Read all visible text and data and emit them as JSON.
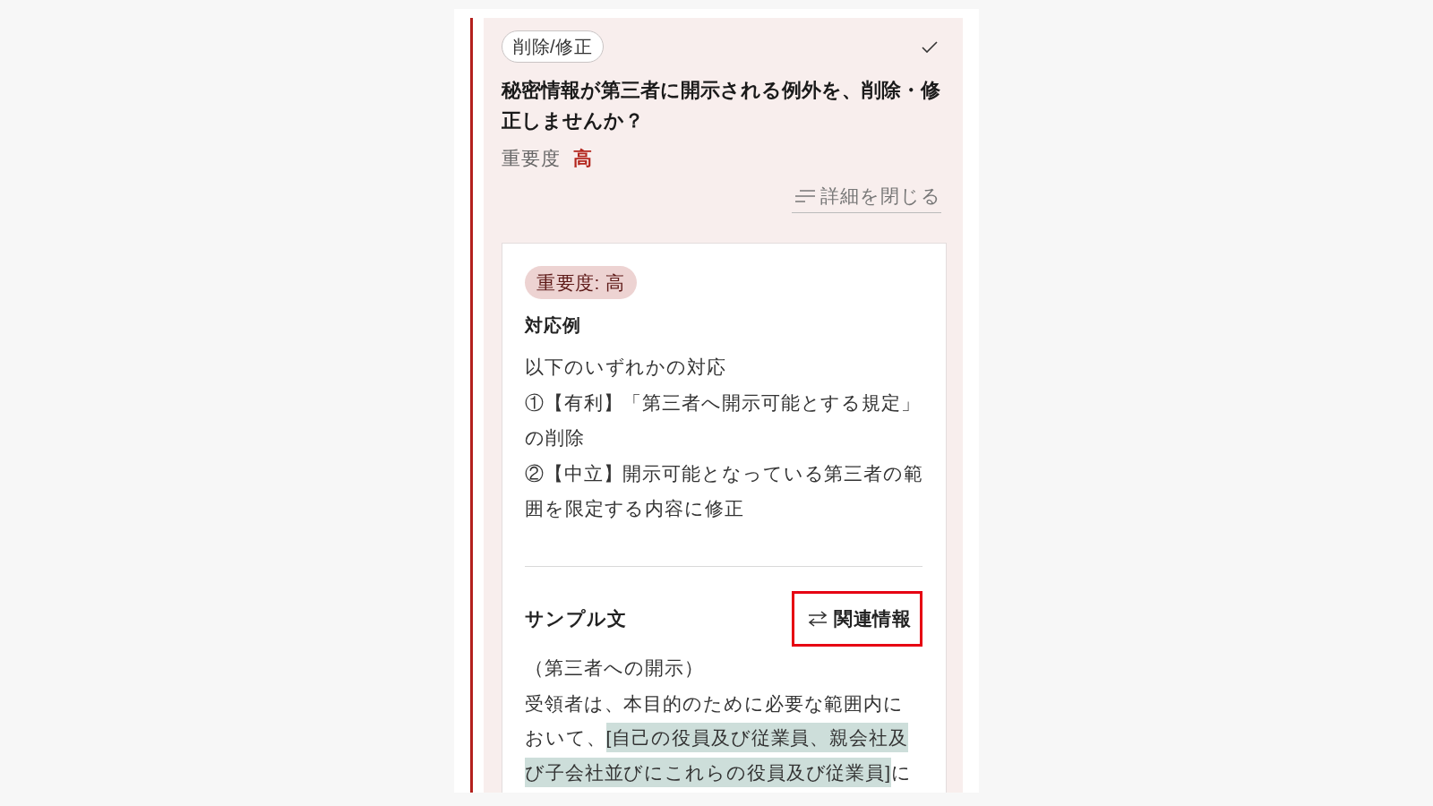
{
  "suggestion": {
    "category_tag": "削除/修正",
    "title": "秘密情報が第三者に開示される例外を、削除・修正しませんか？",
    "importance_label": "重要度",
    "importance_value": "高",
    "details_toggle": {
      "label": "詳細を閉じる",
      "expanded": true
    }
  },
  "details": {
    "importance_badge": "重要度: 高",
    "response_heading": "対応例",
    "response_lines": [
      "以下のいずれかの対応",
      "①【有利】「第三者へ開示可能とする規定」の削除",
      "②【中立】開示可能となっている第三者の範囲を限定する内容に修正"
    ],
    "sample_heading": "サンプル文",
    "related_button": {
      "label": "関連情報",
      "highlighted": true
    },
    "sample_clause_title": "（第三者への開示）",
    "sample_text": [
      {
        "text": "受領者は、本目的のために必要な範囲内において、",
        "highlighted": false
      },
      {
        "text": "[自己の役員及び従業員、親会社及び子会社並びにこれらの役員及び従業員]",
        "highlighted": true
      },
      {
        "text": "に",
        "highlighted": false
      }
    ]
  }
}
